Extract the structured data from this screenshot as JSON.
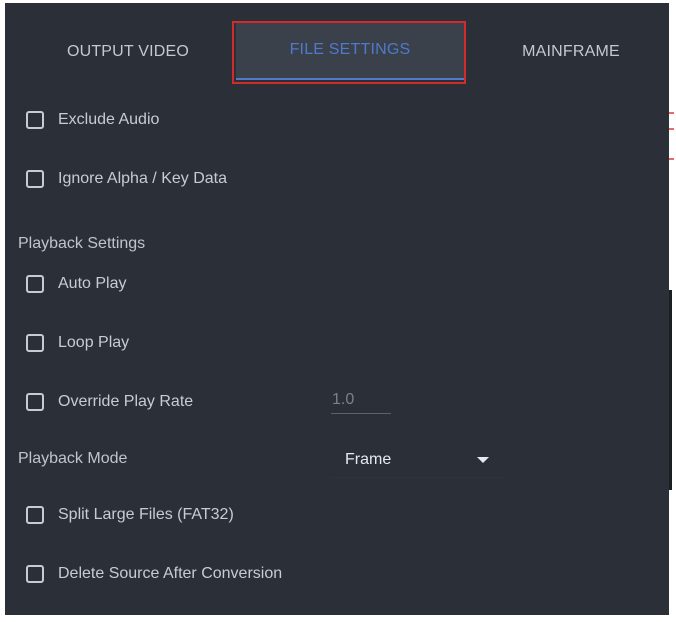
{
  "tabs": [
    {
      "label": "OUTPUT VIDEO",
      "active": false
    },
    {
      "label": "FILE SETTINGS",
      "active": true
    },
    {
      "label": "MAINFRAME",
      "active": false
    }
  ],
  "options": {
    "exclude_audio": {
      "label": "Exclude Audio",
      "checked": false
    },
    "ignore_alpha": {
      "label": "Ignore Alpha / Key Data",
      "checked": false
    },
    "auto_play": {
      "label": "Auto Play",
      "checked": false
    },
    "loop_play": {
      "label": "Loop Play",
      "checked": false
    },
    "override_play_rate": {
      "label": "Override Play Rate",
      "checked": false
    },
    "split_large_files": {
      "label": "Split Large Files (FAT32)",
      "checked": false
    },
    "delete_source": {
      "label": "Delete Source After Conversion",
      "checked": false
    }
  },
  "sections": {
    "playback_settings": "Playback Settings",
    "playback_mode": "Playback Mode"
  },
  "play_rate": {
    "value": "1.0"
  },
  "playback_mode": {
    "selected": "Frame"
  },
  "colors": {
    "panel_bg": "#2b3038",
    "text": "#c7ccd3",
    "active_tab_text": "#4f79c9",
    "highlight_border": "#d42a2a"
  }
}
